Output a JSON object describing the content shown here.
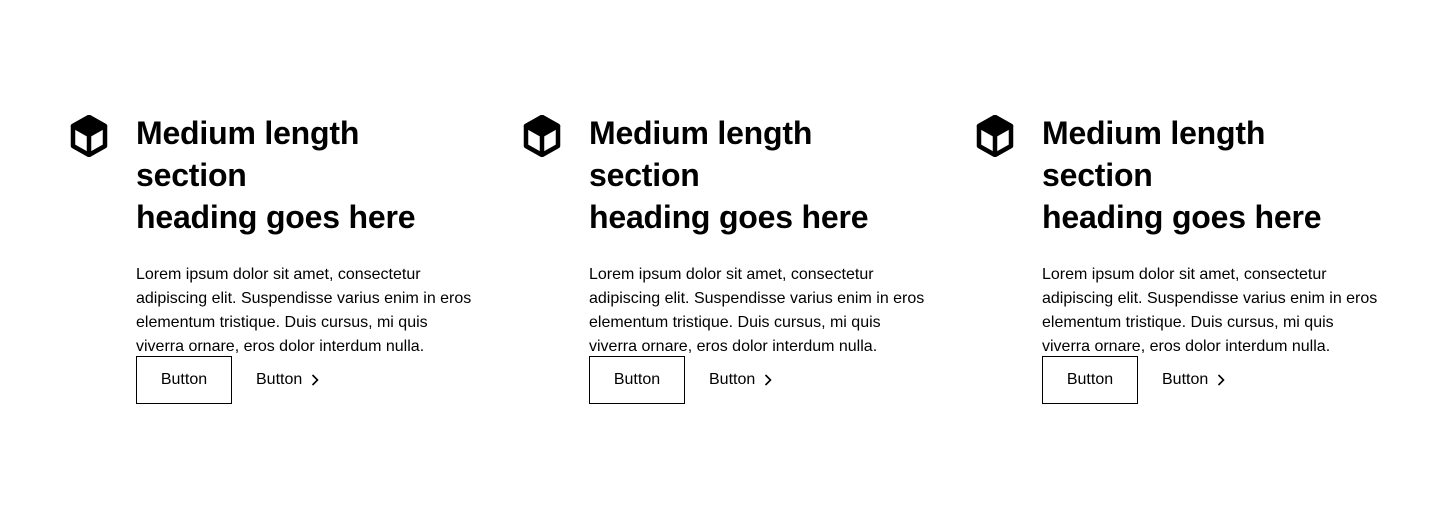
{
  "features": [
    {
      "icon": "cube-icon",
      "heading_line1": "Medium length section",
      "heading_line2": "heading goes here",
      "text": "Lorem ipsum dolor sit amet, consectetur adipiscing elit. Suspendisse varius enim in eros elementum tristique. Duis cursus, mi quis viverra ornare, eros dolor interdum nulla.",
      "primary_button_label": "Button",
      "link_button_label": "Button"
    },
    {
      "icon": "cube-icon",
      "heading_line1": "Medium length section",
      "heading_line2": "heading goes here",
      "text": "Lorem ipsum dolor sit amet, consectetur adipiscing elit. Suspendisse varius enim in eros elementum tristique. Duis cursus, mi quis viverra ornare, eros dolor interdum nulla.",
      "primary_button_label": "Button",
      "link_button_label": "Button"
    },
    {
      "icon": "cube-icon",
      "heading_line1": "Medium length section",
      "heading_line2": "heading goes here",
      "text": "Lorem ipsum dolor sit amet, consectetur adipiscing elit. Suspendisse varius enim in eros elementum tristique. Duis cursus, mi quis viverra ornare, eros dolor interdum nulla.",
      "primary_button_label": "Button",
      "link_button_label": "Button"
    }
  ],
  "colors": {
    "text": "#000000",
    "background": "#ffffff",
    "border": "#000000"
  }
}
